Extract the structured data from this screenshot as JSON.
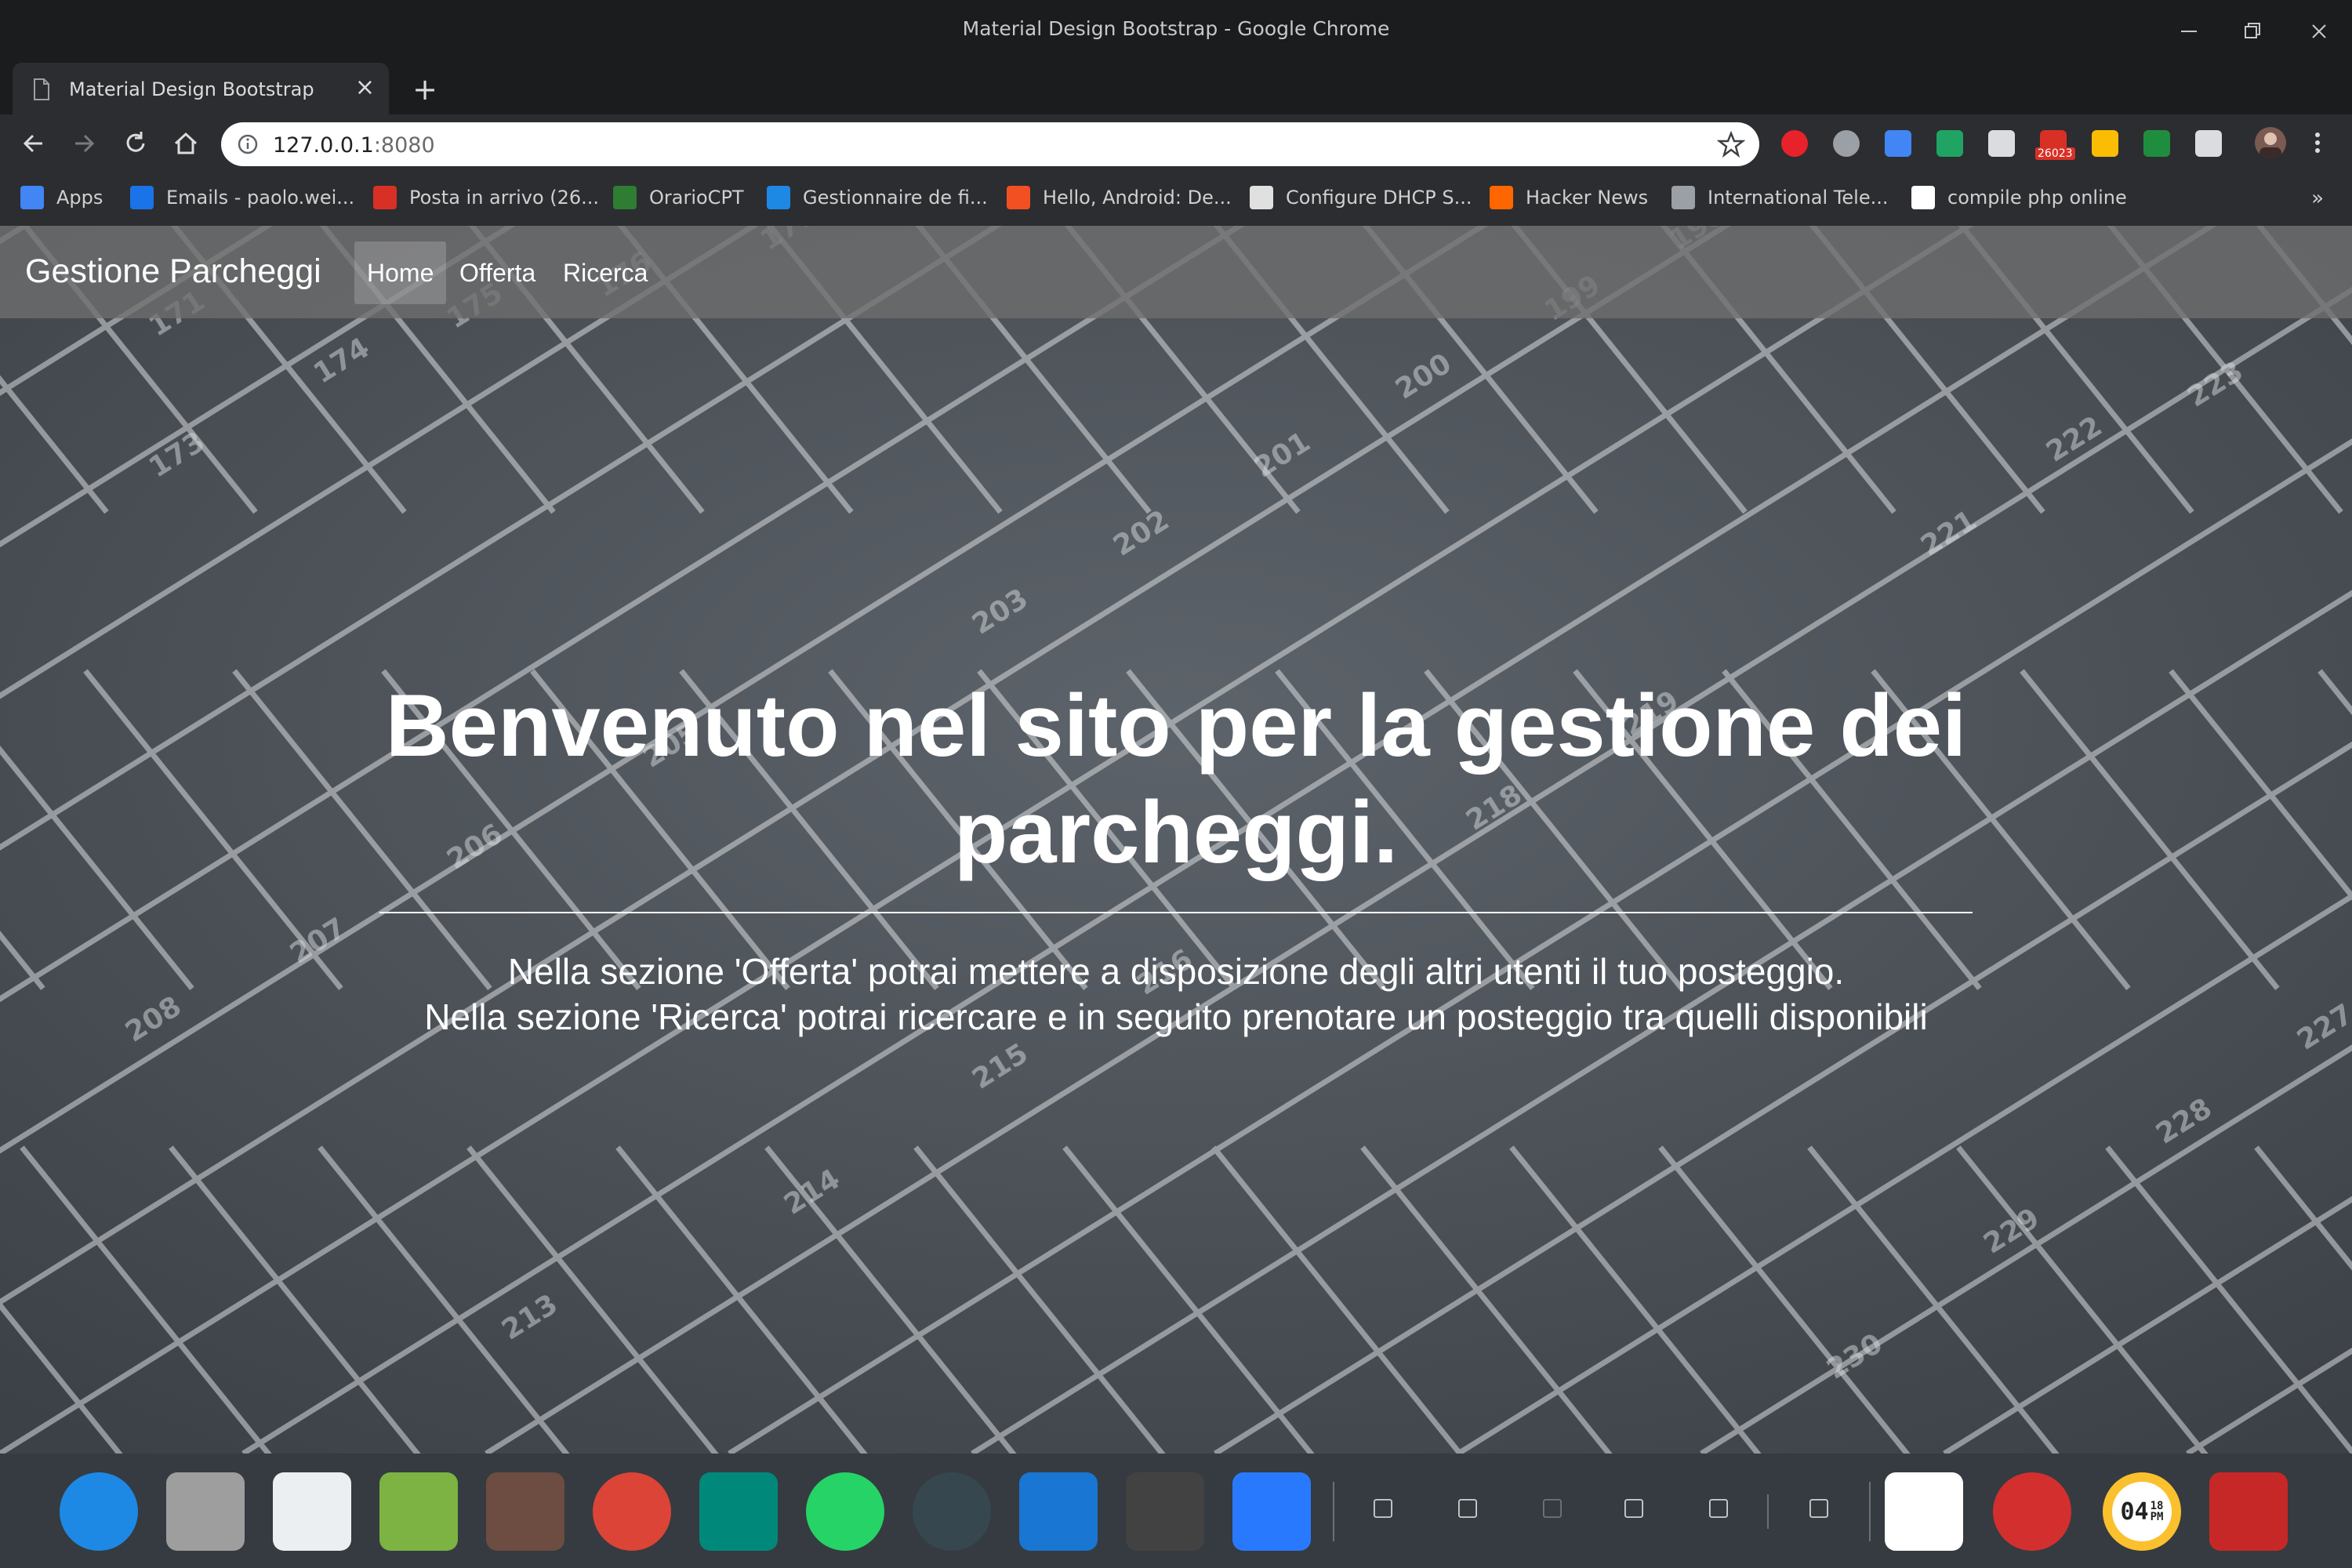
{
  "window": {
    "title": "Material Design Bootstrap - Google Chrome",
    "controls": [
      "minimize",
      "restore",
      "close"
    ]
  },
  "tabs": [
    {
      "title": "Material Design Bootstrap",
      "close": "×"
    }
  ],
  "new_tab": "+",
  "toolbar": {
    "url_host": "127.0.0.1",
    "url_port": ":8080",
    "extensions": [
      {
        "name": "adblock-icon",
        "color": "#e8222a"
      },
      {
        "name": "mail-icon",
        "color": "#9aa0a6"
      },
      {
        "name": "translate-icon",
        "color": "#4285f4"
      },
      {
        "name": "drive-icon",
        "color": "#1fa463"
      },
      {
        "name": "lightbulb-icon",
        "color": "#dadce0"
      },
      {
        "name": "gmail-counter-icon",
        "color": "#d93025",
        "badge": "26023"
      },
      {
        "name": "keep-icon",
        "color": "#fbbc04"
      },
      {
        "name": "classroom-icon",
        "color": "#1e8e3e"
      },
      {
        "name": "css-icon",
        "color": "#dadce0"
      }
    ]
  },
  "bookmarks": [
    {
      "label": "Apps",
      "icon": "apps-grid-icon",
      "color": "#4285f4"
    },
    {
      "label": "Emails - paolo.wei...",
      "icon": "k-icon",
      "color": "#1a73e8"
    },
    {
      "label": "Posta in arrivo (26...",
      "icon": "gmail-icon",
      "color": "#d93025"
    },
    {
      "label": "OrarioCPT",
      "icon": "h-icon",
      "color": "#2e7d32"
    },
    {
      "label": "Gestionnaire de fi...",
      "icon": "globe-icon",
      "color": "#1e88e5"
    },
    {
      "label": "Hello, Android: De...",
      "icon": "microsoft-icon",
      "color": "#f25022"
    },
    {
      "label": "Configure DHCP S...",
      "icon": "config-icon",
      "color": "#e0e0e0"
    },
    {
      "label": "Hacker News",
      "icon": "y-icon",
      "color": "#ff6600"
    },
    {
      "label": "International Tele...",
      "icon": "page-icon",
      "color": "#9aa0a6"
    },
    {
      "label": "compile php online",
      "icon": "t-icon",
      "color": "#ffffff"
    }
  ],
  "bookmarks_more": "»",
  "site": {
    "brand": "Gestione Parcheggi",
    "nav": [
      "Home",
      "Offerta",
      "Ricerca"
    ],
    "active_nav": "Home",
    "hero_title": "Benvenuto nel sito per la gestione dei parcheggi.",
    "hero_lines": [
      "Nella sezione 'Offerta' potrai mettere a disposizione degli altri utenti il tuo posteggio.",
      "Nella sezione 'Ricerca' potrai ricercare e in seguito prenotare un posteggio tra quelli disponibili"
    ],
    "parking_numbers": [
      "171",
      "173",
      "174",
      "175",
      "176",
      "177",
      "198",
      "199",
      "200",
      "201",
      "202",
      "203",
      "205",
      "206",
      "207",
      "208",
      "213",
      "214",
      "215",
      "216",
      "218",
      "219",
      "221",
      "222",
      "223",
      "227",
      "228",
      "229",
      "230"
    ]
  },
  "dock": {
    "apps": [
      {
        "name": "deepin-launcher-icon",
        "color": "#1e88e5"
      },
      {
        "name": "file-manager-icon",
        "color": "#9e9e9e"
      },
      {
        "name": "app-store-icon",
        "color": "#eceff1"
      },
      {
        "name": "music-icon",
        "color": "#7cb342"
      },
      {
        "name": "movie-icon",
        "color": "#6d4c41"
      },
      {
        "name": "chrome-icon",
        "color": "#db4437"
      },
      {
        "name": "settings-icon",
        "color": "#00897b"
      },
      {
        "name": "whatsapp-icon",
        "color": "#25d366"
      },
      {
        "name": "gitkraken-icon",
        "color": "#37474f"
      },
      {
        "name": "vscode-icon",
        "color": "#1976d2"
      },
      {
        "name": "terminal-icon",
        "color": "#424242"
      },
      {
        "name": "wps-writer-icon",
        "color": "#2979ff"
      }
    ],
    "tray": [
      "tray-drive-icon",
      "usb-icon",
      "volume-icon",
      "wifi-icon",
      "battery-icon",
      "collapse-icon"
    ],
    "system": [
      {
        "name": "keyboard-icon",
        "color": "#ffffff"
      },
      {
        "name": "power-icon",
        "color": "#d32f2f"
      },
      {
        "name": "clock-icon",
        "color": "#fbc02d",
        "time": "04",
        "minutes": "18",
        "ampm": "PM"
      },
      {
        "name": "trash-icon",
        "color": "#c62828"
      }
    ]
  }
}
